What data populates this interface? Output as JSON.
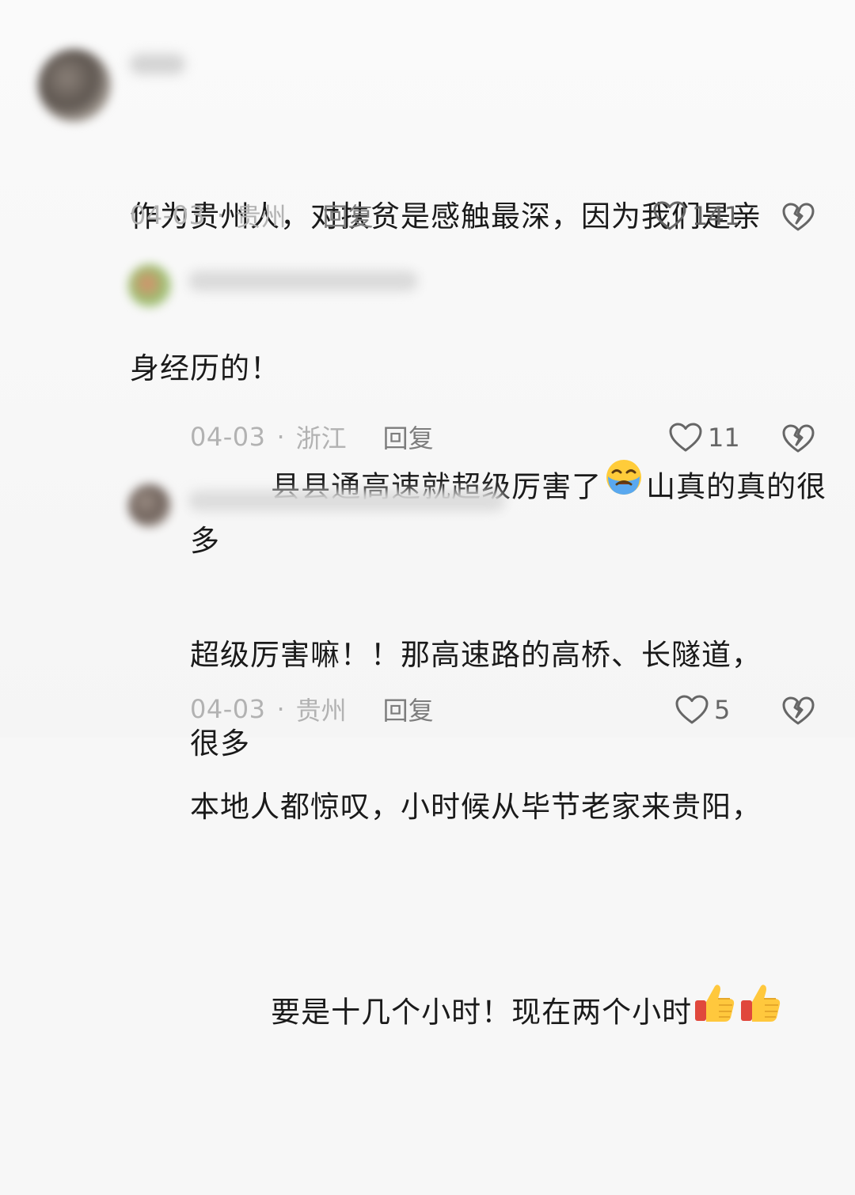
{
  "comments": [
    {
      "text_line1": "作为贵州人，对扶贫是感触最深，因为我们是亲",
      "text_line2": "身经历的！",
      "date": "04-03",
      "location": "贵州",
      "reply_label": "回复",
      "likes": "141"
    },
    {
      "text_part1": "县县通高速就超级厉害了",
      "text_part2": "山真的真的很多",
      "text_line2": "很多",
      "emoji": "loudly-crying-face-icon",
      "date": "04-03",
      "location": "浙江",
      "reply_label": "回复",
      "likes": "11"
    },
    {
      "text_line1": "超级厉害嘛！！那高速路的高桥、长隧道，",
      "text_line2": "本地人都惊叹，小时候从毕节老家来贵阳，",
      "text_line3": "要是十几个小时！现在两个小时",
      "emoji": "thumbs-up-icon",
      "date": "04-03",
      "location": "贵州",
      "reply_label": "回复",
      "likes": "5"
    }
  ],
  "separator": "·",
  "colors": {
    "text": "#1a1a1a",
    "meta": "#b2b2b2",
    "reply": "#7d7d7d",
    "icon": "#666666"
  }
}
